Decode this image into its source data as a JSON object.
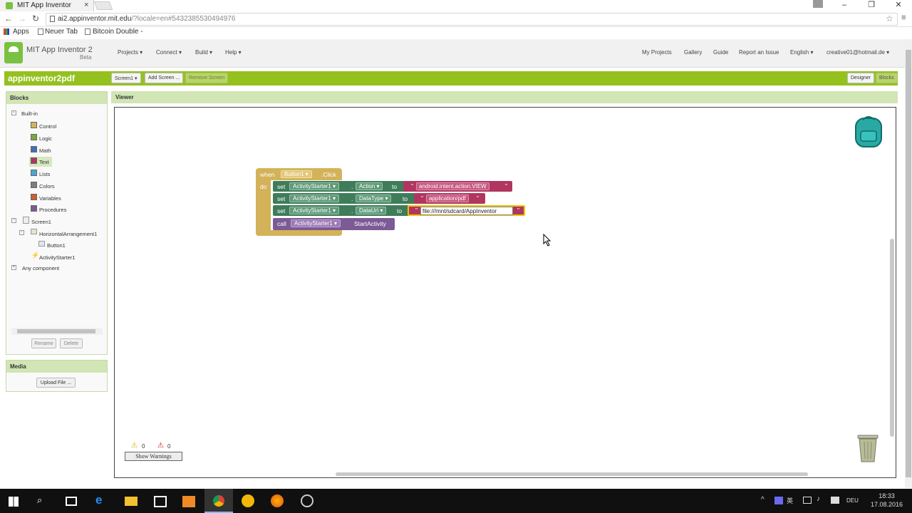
{
  "browser": {
    "tab_title": "MIT App Inventor",
    "url_host": "ai2.appinventor.mit.edu",
    "url_rest": "/?locale=en#5432385530494976",
    "bookmarks": [
      "Apps",
      "Neuer Tab",
      "Bitcoin Double -"
    ],
    "window_controls": [
      "–",
      "❐",
      "✕"
    ]
  },
  "app": {
    "name": "MIT App Inventor 2",
    "beta": "Beta",
    "menus": [
      "Projects ▾",
      "Connect ▾",
      "Build ▾",
      "Help ▾"
    ],
    "right_menus": [
      "My Projects",
      "Gallery",
      "Guide",
      "Report an Issue",
      "English ▾",
      "creative01@hotmail.de ▾"
    ]
  },
  "toolbar": {
    "project_name": "appinventor2pdf",
    "screen_select": "Screen1 ▾",
    "add_screen": "Add Screen ...",
    "remove_screen": "Remove Screen",
    "designer": "Designer",
    "blocks": "Blocks"
  },
  "blocks_panel": {
    "title": "Blocks",
    "builtin_label": "Built-in",
    "builtin": [
      {
        "label": "Control",
        "color": "#d3b25a"
      },
      {
        "label": "Logic",
        "color": "#77ab41"
      },
      {
        "label": "Math",
        "color": "#3f71b5"
      },
      {
        "label": "Text",
        "color": "#b0365f"
      },
      {
        "label": "Lists",
        "color": "#49a6d4"
      },
      {
        "label": "Colors",
        "color": "#7d7d7d"
      },
      {
        "label": "Variables",
        "color": "#d05f2d"
      },
      {
        "label": "Procedures",
        "color": "#7c5a95"
      }
    ],
    "screen": "Screen1",
    "arrangement": "HorizontalArrangement1",
    "button": "Button1",
    "activity": "ActivityStarter1",
    "any_component": "Any component",
    "rename": "Rename",
    "delete": "Delete"
  },
  "media_panel": {
    "title": "Media",
    "upload": "Upload File ..."
  },
  "viewer": {
    "title": "Viewer",
    "warnings_count": "0",
    "errors_count": "0",
    "show_warnings": "Show Warnings"
  },
  "code": {
    "when": "when",
    "event_component": "Button1 ▾",
    "event_name": ".Click",
    "do": "do",
    "set": "set",
    "to": "to",
    "dot": ".",
    "rows": [
      {
        "component": "ActivityStarter1 ▾",
        "property": "Action ▾",
        "value": "android.intent.action.VIEW"
      },
      {
        "component": "ActivityStarter1 ▾",
        "property": "DataType ▾",
        "value": "application/pdf"
      },
      {
        "component": "ActivityStarter1 ▾",
        "property": "DataUri ▾",
        "value": "file:///mnt/sdcard/AppInventor"
      }
    ],
    "call": "call",
    "call_component": "ActivityStarter1 ▾",
    "call_method": "StartActivity"
  },
  "taskbar": {
    "lang": "DEU",
    "time": "18:33",
    "date": "17.08.2016"
  }
}
